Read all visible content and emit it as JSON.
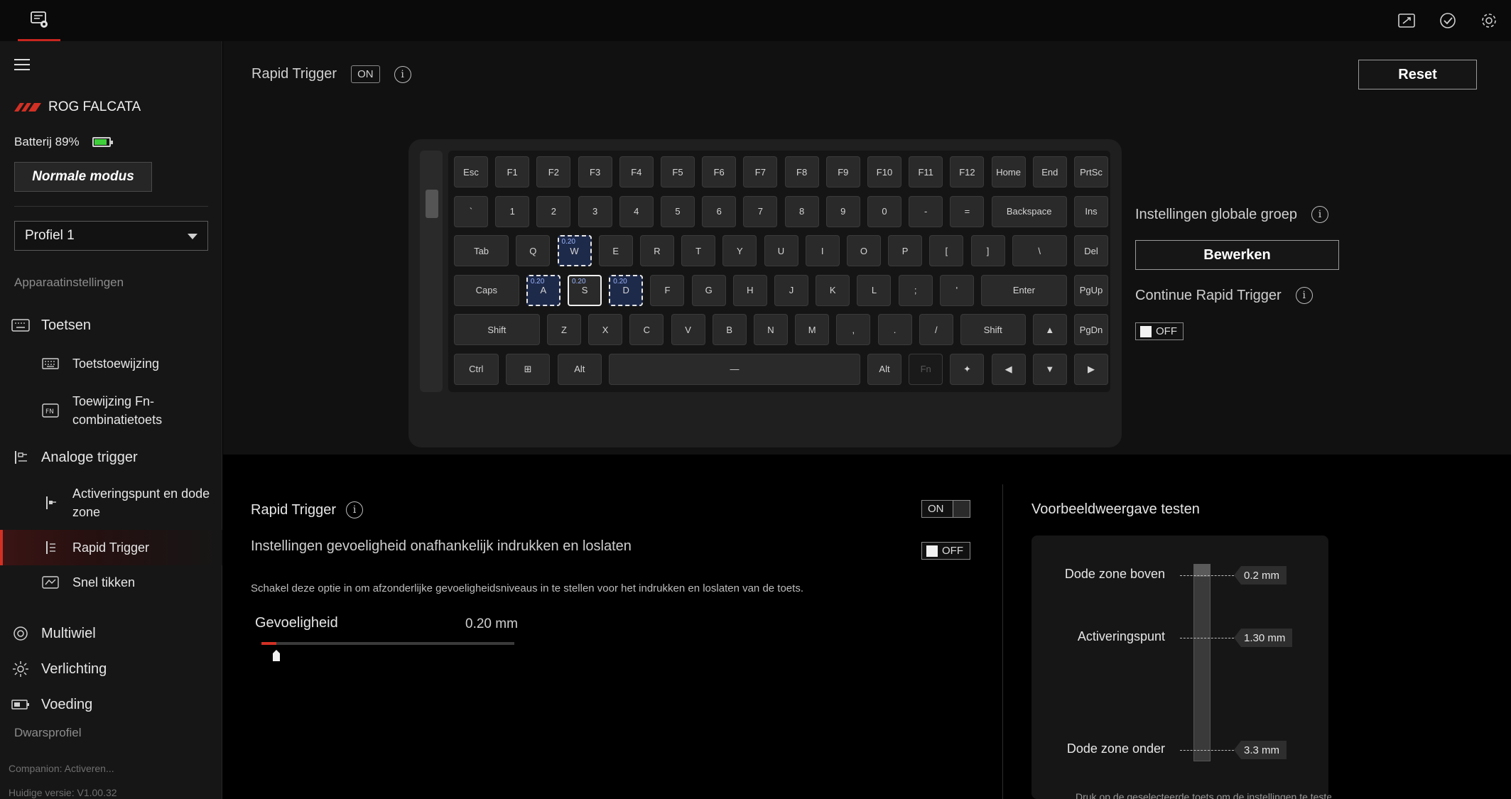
{
  "header": {
    "icons": [
      "wireless-icon",
      "check-sync-icon",
      "settings-gear-icon"
    ]
  },
  "sidebar": {
    "device_name": "ROG FALCATA",
    "battery_label": "Batterij 89%",
    "battery_level": 89,
    "mode_button": "Normale modus",
    "profile_selected": "Profiel 1",
    "section_device": "Apparaatinstellingen",
    "nav": {
      "toetsen": "Toetsen",
      "toetstoewijzing": "Toetstoewijzing",
      "fn_line1": "Toewijzing Fn-",
      "fn_line2": "combinatietoets",
      "analoge": "Analoge trigger",
      "act_line1": "Activeringspunt en dode",
      "act_line2": "zone",
      "rapid": "Rapid Trigger",
      "snel": "Snel tikken",
      "multiwiel": "Multiwiel",
      "verlichting": "Verlichting",
      "voeding": "Voeding"
    },
    "section_profile": "Dwarsprofiel",
    "footer_companion": "Companion: Activeren...",
    "footer_version": "Huidige versie: V1.00.32"
  },
  "top_panel": {
    "title": "Rapid Trigger",
    "status": "ON",
    "reset": "Reset",
    "global_group_label": "Instellingen globale groep",
    "edit_button": "Bewerken",
    "continue_label": "Continue Rapid Trigger",
    "continue_state": "OFF"
  },
  "keyboard": {
    "selected_value": "0.20",
    "rows": [
      [
        "Esc",
        "F1",
        "F2",
        "F3",
        "F4",
        "F5",
        "F6",
        "F7",
        "F8",
        "F9",
        "F10",
        "F11",
        "F12",
        "Home",
        "End",
        "PrtSc"
      ],
      [
        "`",
        "1",
        "2",
        "3",
        "4",
        "5",
        "6",
        "7",
        "8",
        "9",
        "0",
        "-",
        "=",
        "Backspace",
        "Ins"
      ],
      [
        "Tab",
        "Q",
        "W",
        "E",
        "R",
        "T",
        "Y",
        "U",
        "I",
        "O",
        "P",
        "[",
        "]",
        "\\",
        "Del"
      ],
      [
        "Caps",
        "A",
        "S",
        "D",
        "F",
        "G",
        "H",
        "J",
        "K",
        "L",
        ";",
        "'",
        "Enter",
        "PgUp"
      ],
      [
        "Shift",
        "Z",
        "X",
        "C",
        "V",
        "B",
        "N",
        "M",
        ",",
        ".",
        "/",
        "Shift",
        "▲",
        "PgDn"
      ],
      [
        "Ctrl",
        "⊞",
        "Alt",
        "—",
        "Alt",
        "Fn",
        "✦",
        "◀",
        "▼",
        "▶"
      ]
    ]
  },
  "settings": {
    "title": "Rapid Trigger",
    "toggle_state": "ON",
    "separate_label": "Instellingen gevoeligheid onafhankelijk indrukken en loslaten",
    "separate_state": "OFF",
    "description": "Schakel deze optie in om afzonderlijke gevoeligheidsniveaus in te stellen voor het indrukken en loslaten van de toets.",
    "sensitivity_label": "Gevoeligheid",
    "sensitivity_value": "0.20 mm",
    "sensitivity_fraction": 0.06
  },
  "preview": {
    "title": "Voorbeeldweergave testen",
    "top_label": "Dode zone boven",
    "top_value": "0.2 mm",
    "act_label": "Activeringspunt",
    "act_value": "1.30 mm",
    "bottom_label": "Dode zone onder",
    "bottom_value": "3.3 mm",
    "footer": "Druk op de geselecteerde toets om de instellingen te testen"
  }
}
